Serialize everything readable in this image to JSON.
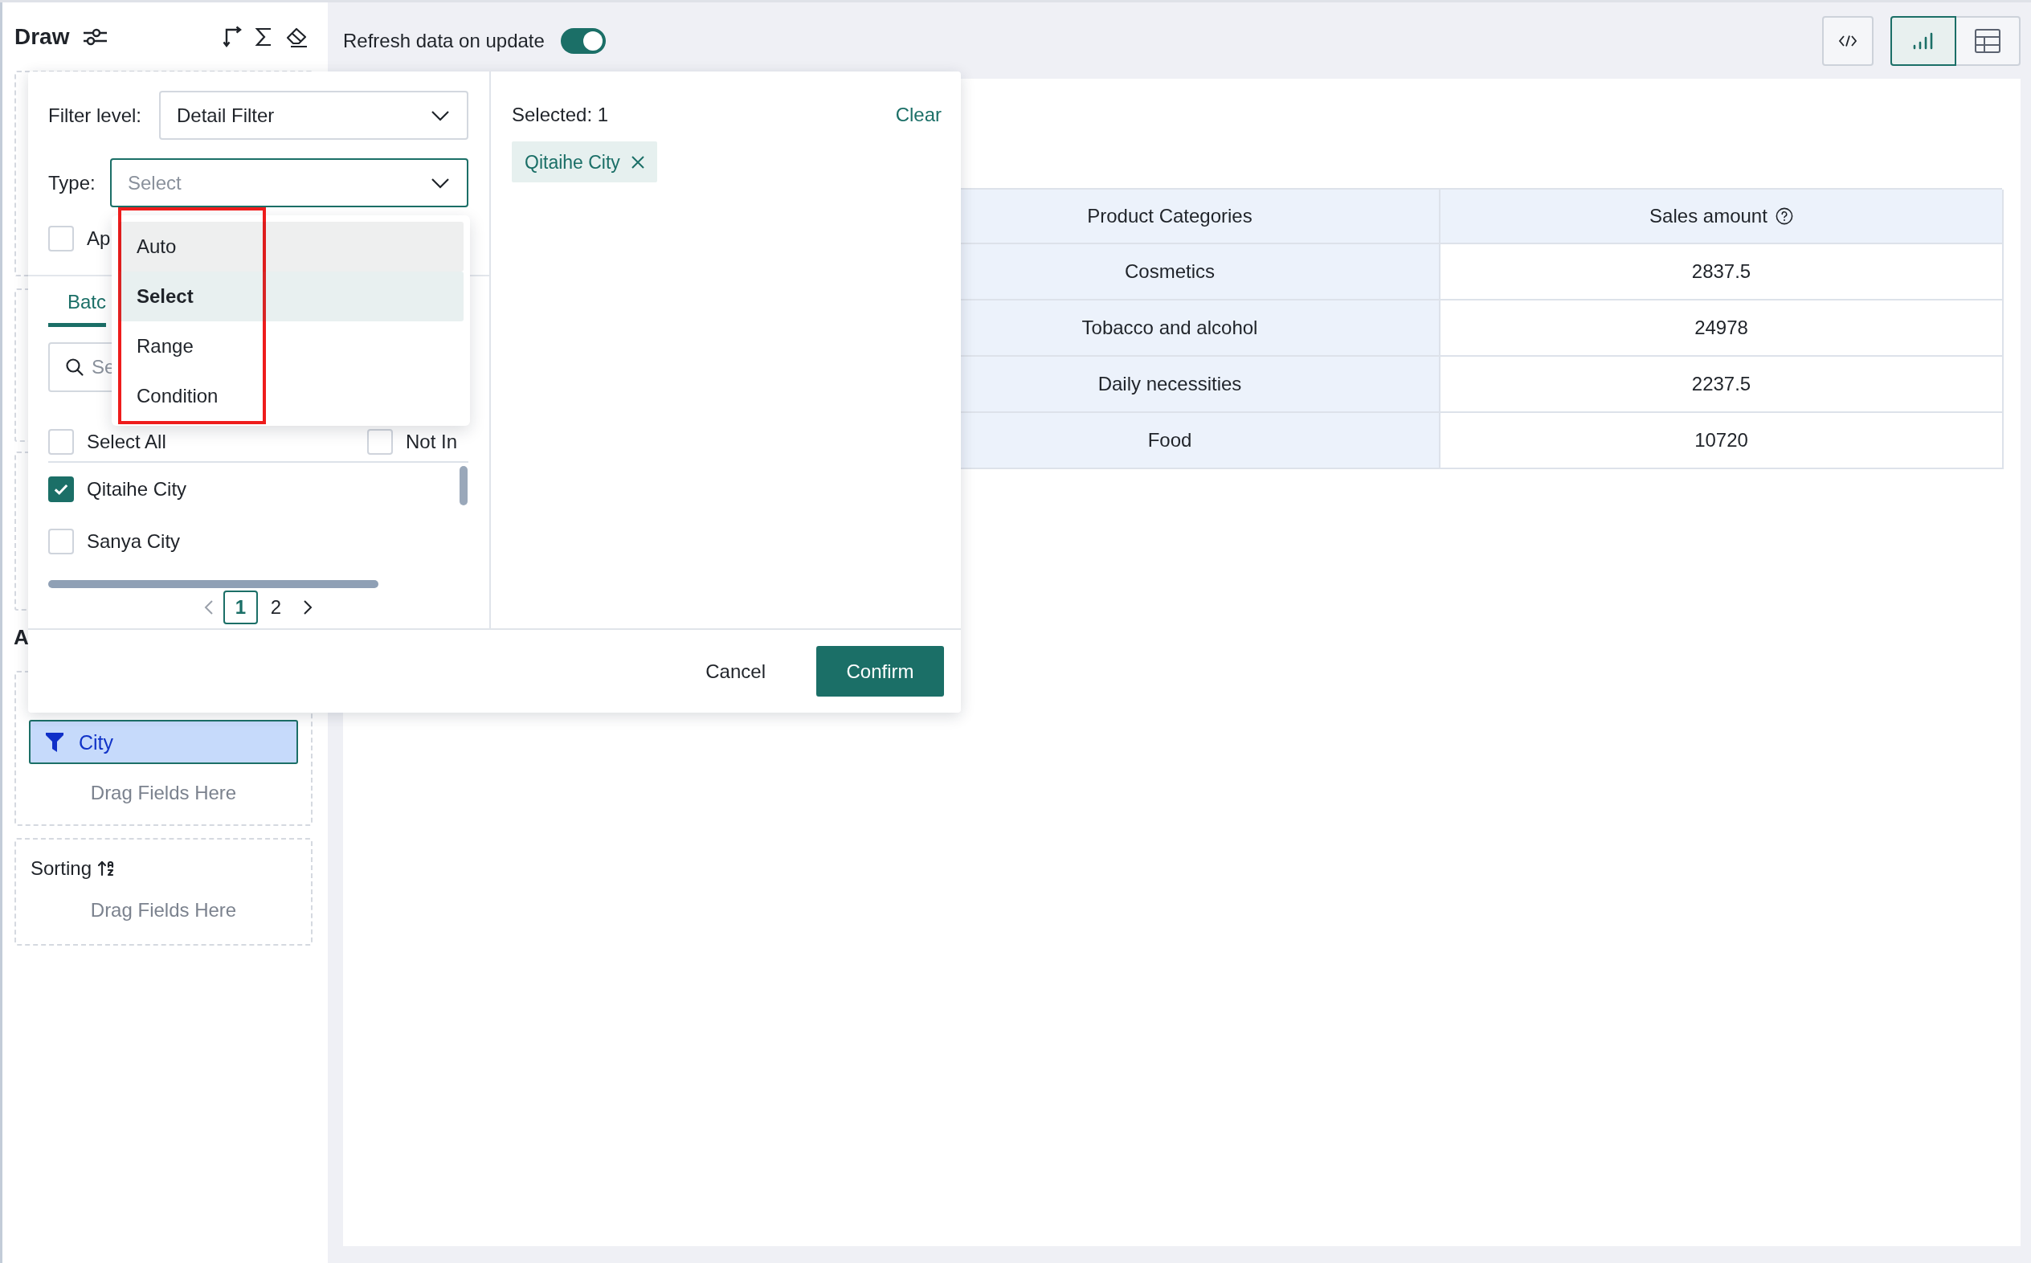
{
  "sidebar": {
    "title": "Draw",
    "section_heading": "A",
    "filters": {
      "fields": [
        {
          "label": "City"
        }
      ],
      "hint": "Drag Fields Here"
    },
    "sorting": {
      "title": "Sorting",
      "hint": "Drag Fields Here"
    }
  },
  "toolbar": {
    "refresh": {
      "label": "Refresh data on update",
      "on": true
    },
    "views": [
      {
        "kind": "chart",
        "selected": true
      },
      {
        "kind": "table",
        "selected": false
      }
    ]
  },
  "filter_popup": {
    "filter_level": {
      "label": "Filter level:",
      "value": "Detail Filter"
    },
    "type": {
      "label": "Type:",
      "placeholder": "Select",
      "expanded": true,
      "options": [
        {
          "label": "Auto",
          "selected": false,
          "hovered": true
        },
        {
          "label": "Select",
          "selected": true,
          "hovered": false
        },
        {
          "label": "Range",
          "selected": false,
          "hovered": false
        },
        {
          "label": "Condition",
          "selected": false,
          "hovered": false
        }
      ]
    },
    "apply": {
      "label": "Ap",
      "checked": false
    },
    "tabs": [
      {
        "label": "Batc",
        "selected": true
      }
    ],
    "search": {
      "placeholder": "Se"
    },
    "select_all": {
      "label": "Select All",
      "checked": false
    },
    "not_in": {
      "label": "Not In",
      "checked": false
    },
    "values": [
      {
        "label": "Qitaihe City",
        "checked": true
      },
      {
        "label": "Sanya City",
        "checked": false
      }
    ],
    "pages": [
      {
        "label": "1",
        "selected": true
      },
      {
        "label": "2",
        "selected": false
      }
    ],
    "selected": {
      "title": "Selected: 1",
      "clear": "Clear",
      "tags": [
        {
          "label": "Qitaihe City"
        }
      ]
    },
    "buttons": [
      {
        "label": "Cancel",
        "kind": "secondary"
      },
      {
        "label": "Confirm",
        "kind": "primary"
      }
    ]
  },
  "table": {
    "columns": [
      {
        "label": "Product Categories",
        "info": false
      },
      {
        "label": "Sales amount",
        "info": true
      }
    ],
    "rows": [
      [
        "Cosmetics",
        "2837.5"
      ],
      [
        "Tobacco and alcohol",
        "24978"
      ],
      [
        "Daily necessities",
        "2237.5"
      ],
      [
        "Food",
        "10720"
      ]
    ]
  }
}
